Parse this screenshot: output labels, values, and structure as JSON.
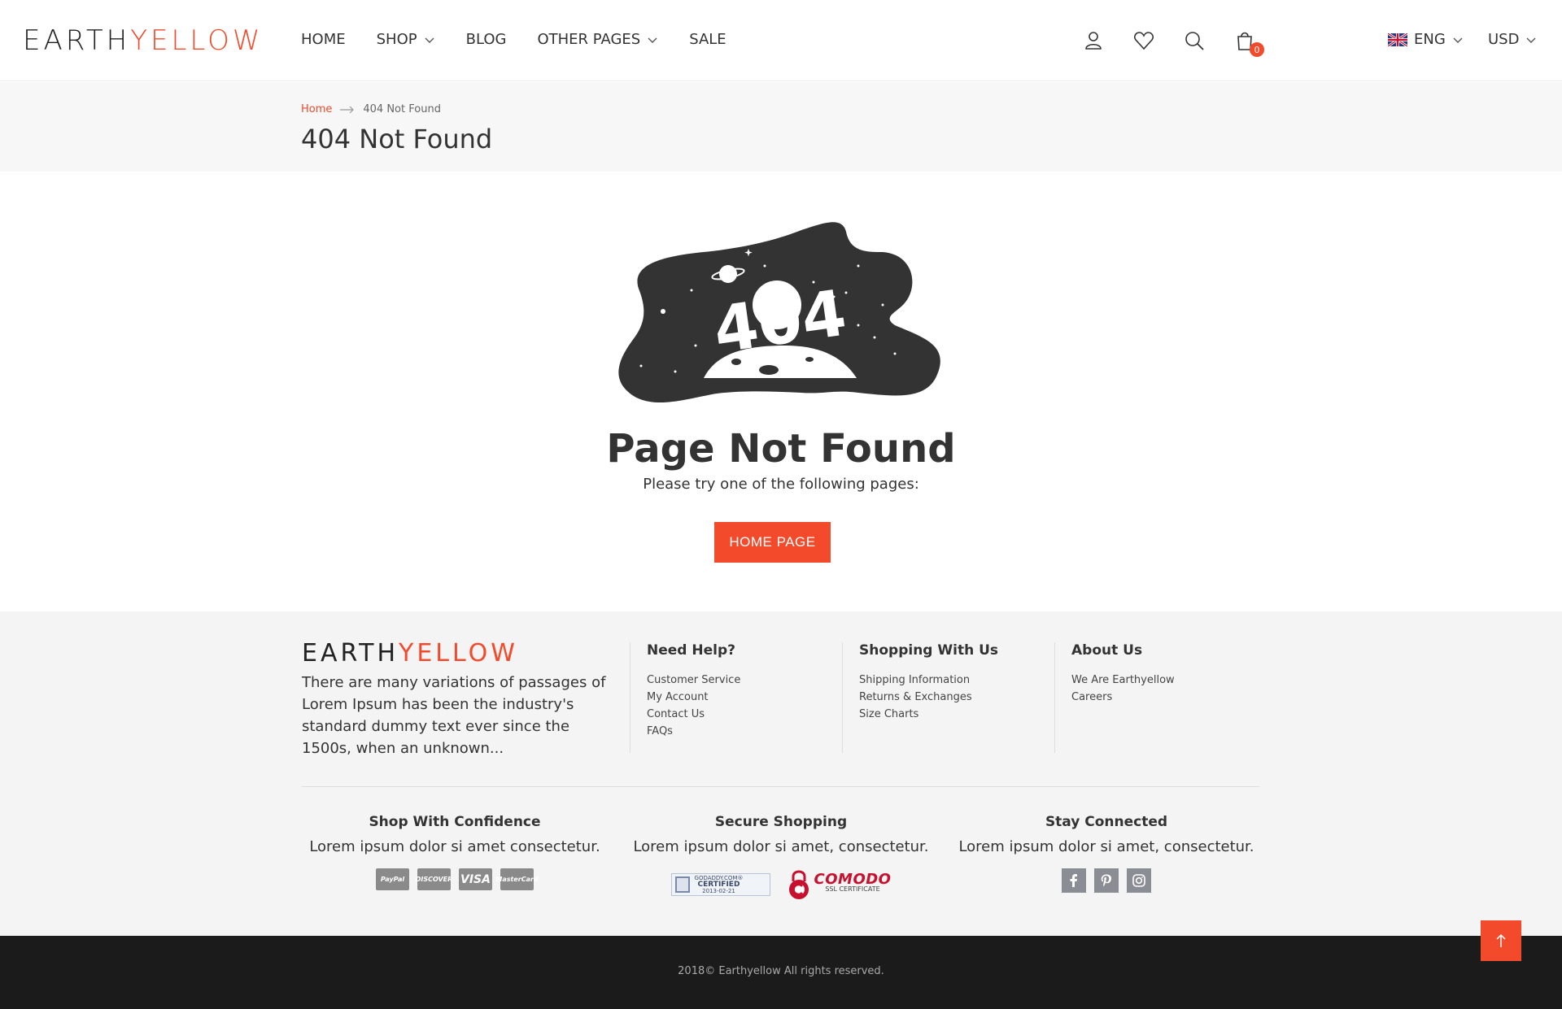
{
  "header": {
    "logo_part1": "EARTH",
    "logo_part2": "YELLOW",
    "nav": [
      {
        "label": "HOME",
        "has_dropdown": false
      },
      {
        "label": "SHOP",
        "has_dropdown": true
      },
      {
        "label": "BLOG",
        "has_dropdown": false
      },
      {
        "label": "OTHER PAGES",
        "has_dropdown": true
      },
      {
        "label": "SALE",
        "has_dropdown": false
      }
    ],
    "icons": [
      "user-icon",
      "heart-icon",
      "search-icon",
      "shopping-bag-icon"
    ],
    "cart_count": "0",
    "language": "ENG",
    "currency": "USD"
  },
  "breadcrumb": {
    "home": "Home",
    "current": "404 Not Found"
  },
  "page_title": "404 Not Found",
  "error": {
    "illustration_text": "404",
    "title": "Page Not Found",
    "subtitle": "Please try one of the following pages:",
    "button": "HOME PAGE"
  },
  "footer": {
    "logo_part1": "EARTH",
    "logo_part2": "YELLOW",
    "about": "There are many variations of passages of Lorem Ipsum has been the industry's standard dummy text ever since the 1500s, when an unknown...",
    "columns": [
      {
        "title": "Need Help?",
        "links": [
          "Customer Service",
          "My Account",
          "Contact Us",
          "FAQs"
        ]
      },
      {
        "title": "Shopping With Us",
        "links": [
          "Shipping Information",
          "Returns & Exchanges",
          "Size Charts"
        ]
      },
      {
        "title": "About Us",
        "links": [
          "We Are Earthyellow",
          "Careers"
        ]
      }
    ],
    "blocks": [
      {
        "title": "Shop With Confidence",
        "text": "Lorem ipsum dolor si amet consectetur."
      },
      {
        "title": "Secure Shopping",
        "text": "Lorem ipsum dolor si amet, consectetur."
      },
      {
        "title": "Stay Connected",
        "text": "Lorem ipsum dolor si amet, consectetur."
      }
    ],
    "payments": [
      "PayPal",
      "DISCOVER",
      "VISA",
      "MasterCard"
    ],
    "godaddy": {
      "line1": "GODADDY.COM®",
      "line2": "CERTIFIED",
      "line3": "2013-02-21"
    },
    "comodo": {
      "line1": "COMODO",
      "line2": "SSL CERTIFICATE"
    },
    "social": [
      "facebook-icon",
      "pinterest-icon",
      "instagram-icon"
    ],
    "copyright": "2018© Earthyellow All rights reserved."
  },
  "colors": {
    "accent": "#f24a2b",
    "footer_bg": "#f4f4f4",
    "bottom_bar": "#1b1b1b",
    "banner_bg": "#f7f7f7"
  }
}
